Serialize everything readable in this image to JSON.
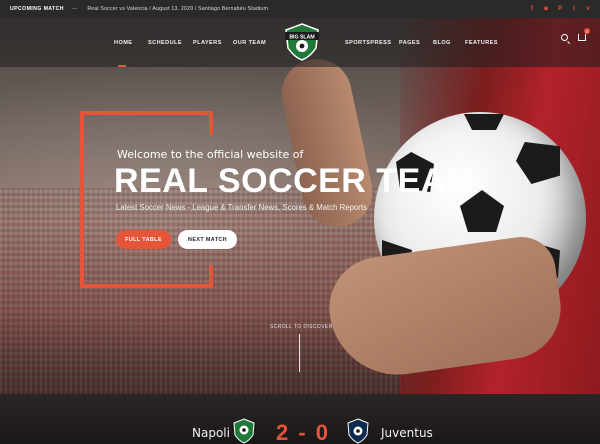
{
  "topbar": {
    "label": "UPCOMING MATCH",
    "separator": "—",
    "match": "Real Soccer vs Valencia / August 13, 2020 / Santiago Bernabéu Stadium",
    "socials": [
      "facebook-icon",
      "instagram-icon",
      "pinterest-icon",
      "twitter-icon",
      "vimeo-icon"
    ]
  },
  "nav": {
    "left": [
      "HOME",
      "SCHEDULE",
      "PLAYERS",
      "OUR TEAM"
    ],
    "right": [
      "SPORTSPRESS",
      "PAGES",
      "BLOG",
      "FEATURES"
    ],
    "active": "HOME",
    "logo_text": "BIG SLAM",
    "cart_count": "0"
  },
  "hero": {
    "welcome": "Welcome to the official website of",
    "headline": "REAL SOCCER TEAM",
    "subtitle": "Latest Soccer News - League & Transfer News, Scores & Match Reports",
    "btn_primary": "FULL TABLE",
    "btn_secondary": "NEXT MATCH",
    "scroll": "SCROLL TO DISCOVER"
  },
  "scoreboard": {
    "home": "Napoli",
    "score": "2 - 0",
    "away": "Juventus"
  },
  "colors": {
    "accent": "#e6553a",
    "dark": "#2b2a2a"
  }
}
